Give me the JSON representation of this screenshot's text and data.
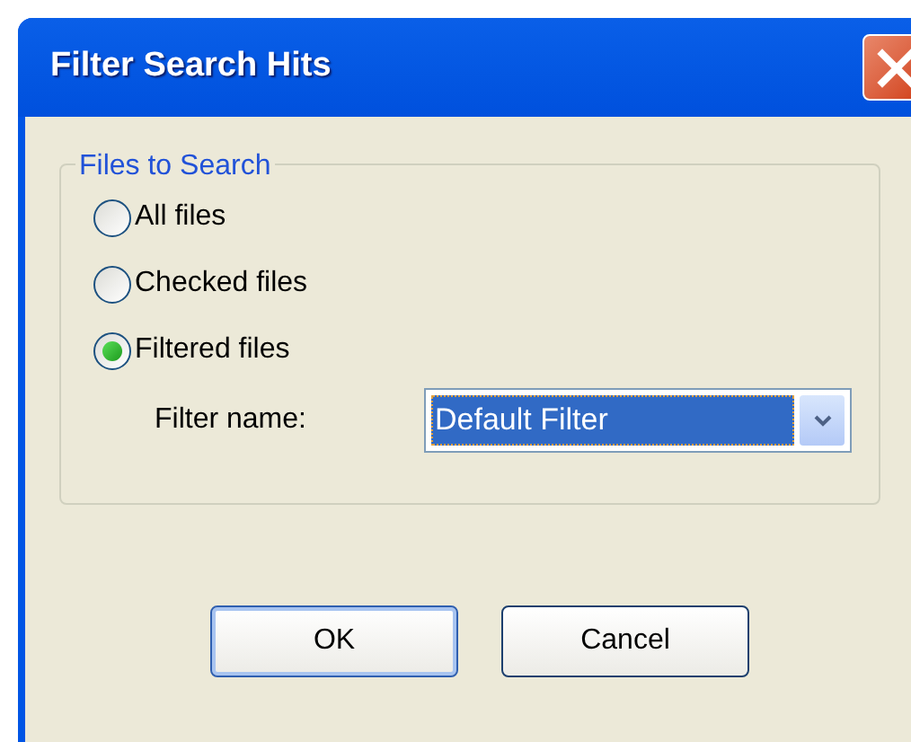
{
  "window": {
    "title": "Filter Search Hits"
  },
  "group": {
    "legend": "Files to Search",
    "options": [
      {
        "label": "All files",
        "selected": false
      },
      {
        "label": "Checked files",
        "selected": false
      },
      {
        "label": "Filtered files",
        "selected": true
      }
    ],
    "filter_name": {
      "label": "Filter name:",
      "value": "Default Filter"
    }
  },
  "buttons": [
    {
      "label": "OK",
      "default": true
    },
    {
      "label": "Cancel",
      "default": false
    }
  ]
}
